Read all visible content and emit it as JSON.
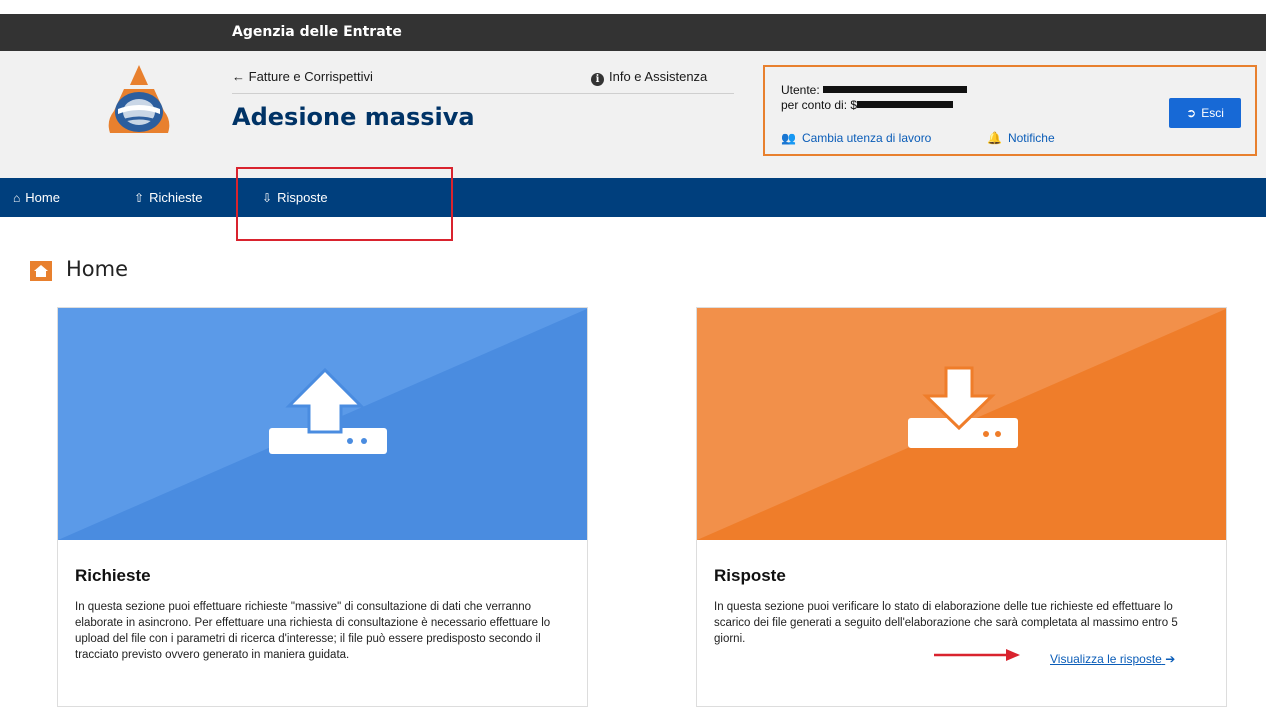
{
  "topbar": {
    "agency": "Agenzia delle Entrate"
  },
  "header": {
    "back_link": "Fatture e Corrispettivi",
    "title": "Adesione massiva",
    "info": "Info e Assistenza"
  },
  "user": {
    "utente_label": "Utente:",
    "conto_label": "per conto di:",
    "conto_prefix": "$",
    "cambia_label": "Cambia utenza di lavoro",
    "notifiche_label": "Notifiche",
    "esci_label": "Esci"
  },
  "nav": {
    "items": [
      {
        "label": "Home",
        "icon": "home-icon"
      },
      {
        "label": "Richieste",
        "icon": "upload-icon"
      },
      {
        "label": "Risposte",
        "icon": "download-icon"
      }
    ]
  },
  "main": {
    "title": "Home"
  },
  "cards": [
    {
      "title": "Richieste",
      "text": "In questa sezione puoi effettuare richieste \"massive\" di consultazione di dati che verranno elaborate in asincrono. Per effettuare una richiesta di consultazione è necessario effettuare lo upload del file con i parametri di ricerca d'interesse; il file può essere predisposto secondo il tracciato previsto ovvero generato in maniera guidata.",
      "color": "#4a8ce0"
    },
    {
      "title": "Risposte",
      "text": "In questa sezione puoi verificare lo stato di elaborazione delle tue richieste ed effettuare lo scarico dei file generati a seguito dell'elaborazione che sarà completata al massimo entro 5 giorni.",
      "link": "Visualizza le risposte",
      "color": "#ef7d2a"
    }
  ],
  "colors": {
    "nav": "#003f7d",
    "title": "#003366",
    "accent": "#e8802e",
    "link": "#0b5db8",
    "highlight": "#d9232e"
  }
}
